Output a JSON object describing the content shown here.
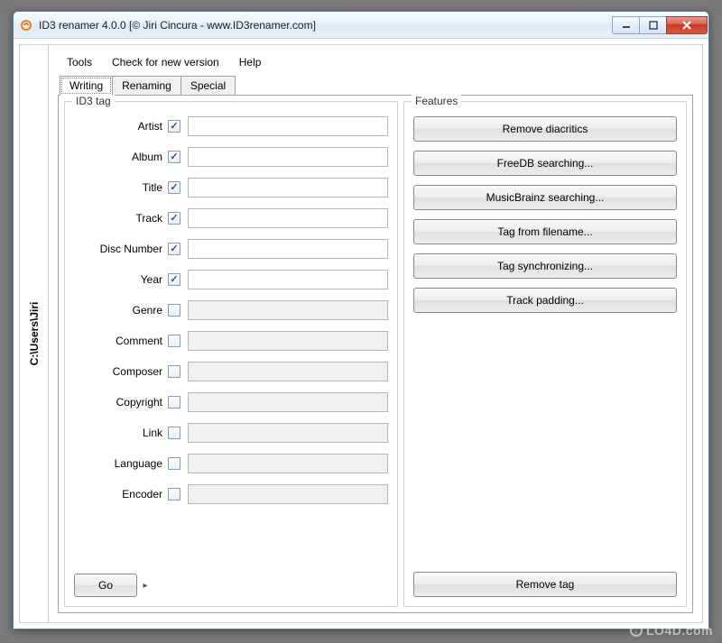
{
  "window": {
    "title": "ID3 renamer 4.0.0 [© Jiri Cincura - www.ID3renamer.com]"
  },
  "sidebar": {
    "path": "C:\\Users\\Jiri"
  },
  "menu": {
    "tools": "Tools",
    "check": "Check for new version",
    "help": "Help"
  },
  "tabs": [
    {
      "id": "writing",
      "label": "Writing",
      "active": true
    },
    {
      "id": "renaming",
      "label": "Renaming",
      "active": false
    },
    {
      "id": "special",
      "label": "Special",
      "active": false
    }
  ],
  "id3_group": {
    "legend": "ID3 tag",
    "fields": [
      {
        "id": "artist",
        "label": "Artist",
        "checked": true,
        "enabled": true,
        "value": ""
      },
      {
        "id": "album",
        "label": "Album",
        "checked": true,
        "enabled": true,
        "value": ""
      },
      {
        "id": "title",
        "label": "Title",
        "checked": true,
        "enabled": true,
        "value": ""
      },
      {
        "id": "track",
        "label": "Track",
        "checked": true,
        "enabled": true,
        "value": ""
      },
      {
        "id": "discnumber",
        "label": "Disc Number",
        "checked": true,
        "enabled": true,
        "value": ""
      },
      {
        "id": "year",
        "label": "Year",
        "checked": true,
        "enabled": true,
        "value": ""
      },
      {
        "id": "genre",
        "label": "Genre",
        "checked": false,
        "enabled": false,
        "value": ""
      },
      {
        "id": "comment",
        "label": "Comment",
        "checked": false,
        "enabled": false,
        "value": ""
      },
      {
        "id": "composer",
        "label": "Composer",
        "checked": false,
        "enabled": false,
        "value": ""
      },
      {
        "id": "copyright",
        "label": "Copyright",
        "checked": false,
        "enabled": false,
        "value": ""
      },
      {
        "id": "link",
        "label": "Link",
        "checked": false,
        "enabled": false,
        "value": ""
      },
      {
        "id": "language",
        "label": "Language",
        "checked": false,
        "enabled": false,
        "value": ""
      },
      {
        "id": "encoder",
        "label": "Encoder",
        "checked": false,
        "enabled": false,
        "value": ""
      }
    ],
    "go_label": "Go"
  },
  "features_group": {
    "legend": "Features",
    "buttons": [
      {
        "id": "remove-diacritics",
        "label": "Remove diacritics"
      },
      {
        "id": "freedb",
        "label": "FreeDB searching..."
      },
      {
        "id": "musicbrainz",
        "label": "MusicBrainz searching..."
      },
      {
        "id": "tag-from-filename",
        "label": "Tag from filename..."
      },
      {
        "id": "tag-sync",
        "label": "Tag synchronizing..."
      },
      {
        "id": "track-padding",
        "label": "Track padding..."
      }
    ],
    "remove_tag_label": "Remove tag"
  },
  "watermark": "LO4D.com"
}
